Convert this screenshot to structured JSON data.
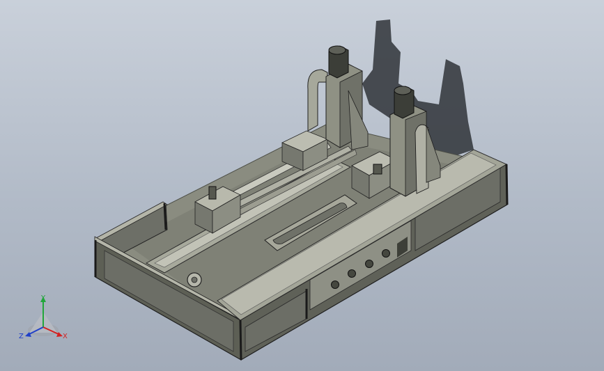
{
  "view": {
    "model": "cad-assembly-isometric",
    "colors": {
      "background_top": "#c9d0da",
      "background_bottom": "#a2abb9",
      "body": "#8f9184",
      "body_light": "#b4b5a8",
      "body_dark": "#5d5f55",
      "frame_black": "#262626",
      "panel": "#6c6e66",
      "shadow": "#2b2e33",
      "axis_x": "#d42020",
      "axis_y": "#21a63a",
      "axis_z": "#2040c8"
    }
  },
  "triad": {
    "x_label": "X",
    "y_label": "Y",
    "z_label": "Z"
  }
}
